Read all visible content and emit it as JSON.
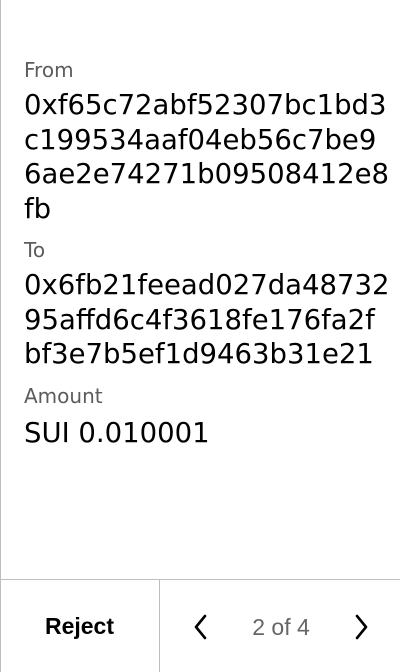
{
  "transaction": {
    "from_label": "From",
    "from_value": "0xf65c72abf52307bc1bd3c199534aaf04eb56c7be96ae2e74271b09508412e8fb",
    "to_label": "To",
    "to_value": "0x6fb21feead027da4873295affd6c4f3618fe176fa2fbf3e7b5ef1d9463b31e21",
    "amount_label": "Amount",
    "amount_value": "SUI 0.010001"
  },
  "footer": {
    "reject_label": "Reject",
    "page_indicator": "2 of 4",
    "prev_icon": "chevron-left-icon",
    "next_icon": "chevron-right-icon"
  },
  "colors": {
    "label": "#5c5c5c",
    "value": "#000000",
    "border": "#bdbdbd",
    "page_indicator": "#666666"
  }
}
